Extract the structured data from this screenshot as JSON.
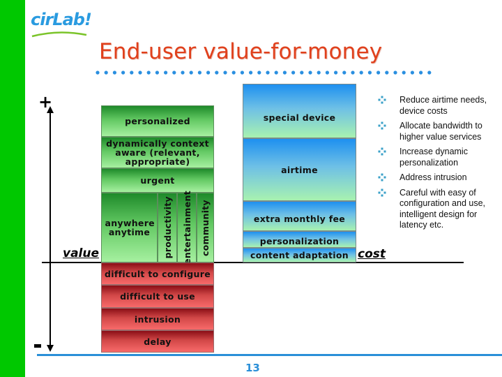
{
  "slide": {
    "logo_text": "cirLab!",
    "title": "End-user value-for-money",
    "page_number": "13",
    "colors": {
      "sidebar": "#00c800",
      "title": "#e0401c",
      "accent_blue": "#2a8fd8",
      "value_green": "#62c862",
      "cost_blue": "#1e90f0",
      "negative_red": "#d24848"
    }
  },
  "axis": {
    "plus_symbol": "+",
    "minus_symbol": "-",
    "value_label": "value",
    "cost_label": "cost"
  },
  "value_stack": {
    "rows": [
      {
        "label": "personalized"
      },
      {
        "label": "dynamically context aware (relevant, appropriate)"
      },
      {
        "label": "urgent"
      }
    ],
    "base_columns": [
      {
        "label": "anywhere anytime",
        "orientation": "horizontal"
      },
      {
        "label": "productivity",
        "orientation": "vertical"
      },
      {
        "label": "entertainment",
        "orientation": "vertical"
      },
      {
        "label": "community",
        "orientation": "vertical"
      }
    ]
  },
  "negative_stack": {
    "rows": [
      {
        "label": "difficult to configure"
      },
      {
        "label": "difficult to use"
      },
      {
        "label": "intrusion"
      },
      {
        "label": "delay"
      }
    ]
  },
  "cost_stack": {
    "rows": [
      {
        "label": "special device"
      },
      {
        "label": "airtime"
      },
      {
        "label": "extra monthly fee"
      },
      {
        "label": "personalization"
      },
      {
        "label": "content adaptation"
      }
    ]
  },
  "bullets": [
    {
      "icon": "diamond-bullet-icon",
      "text": "Reduce airtime needs, device costs"
    },
    {
      "icon": "diamond-bullet-icon",
      "text": "Allocate bandwidth to higher value services"
    },
    {
      "icon": "diamond-bullet-icon",
      "text": "Increase dynamic personalization"
    },
    {
      "icon": "diamond-bullet-icon",
      "text": "Address intrusion"
    },
    {
      "icon": "diamond-bullet-icon",
      "text": "Careful with easy of configuration and use, intelligent design for latency etc."
    }
  ]
}
